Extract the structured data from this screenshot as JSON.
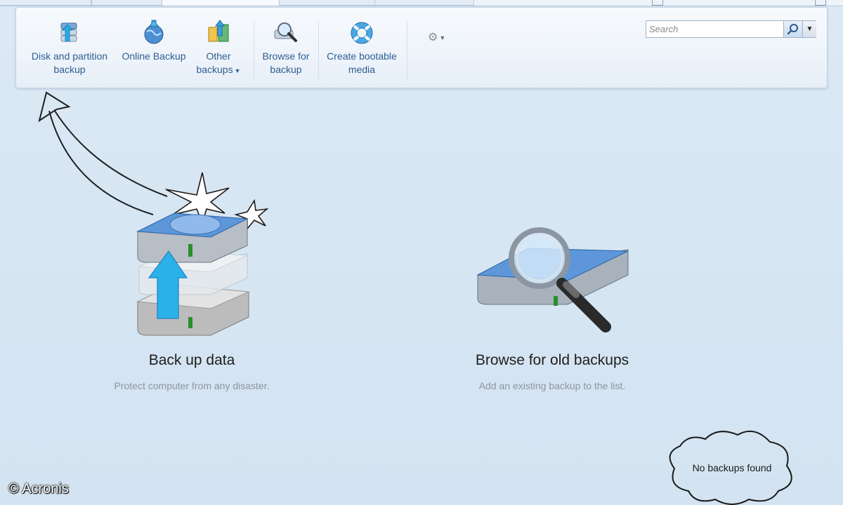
{
  "toolbar": {
    "disk_backup": "Disk and partition backup",
    "online_backup": "Online Backup",
    "other_backups": "Other backups",
    "browse_backup": "Browse for backup",
    "create_media": "Create bootable media"
  },
  "search": {
    "placeholder": "Search"
  },
  "main": {
    "backup_title": "Back up data",
    "backup_desc": "Protect computer from any disaster.",
    "browse_title": "Browse for old backups",
    "browse_desc": "Add an existing backup to the list."
  },
  "annotation": {
    "cloud_text": "No backups found"
  },
  "watermark": "© Acronis",
  "colors": {
    "accent": "#2f5d92",
    "background": "#d7e6f3"
  }
}
